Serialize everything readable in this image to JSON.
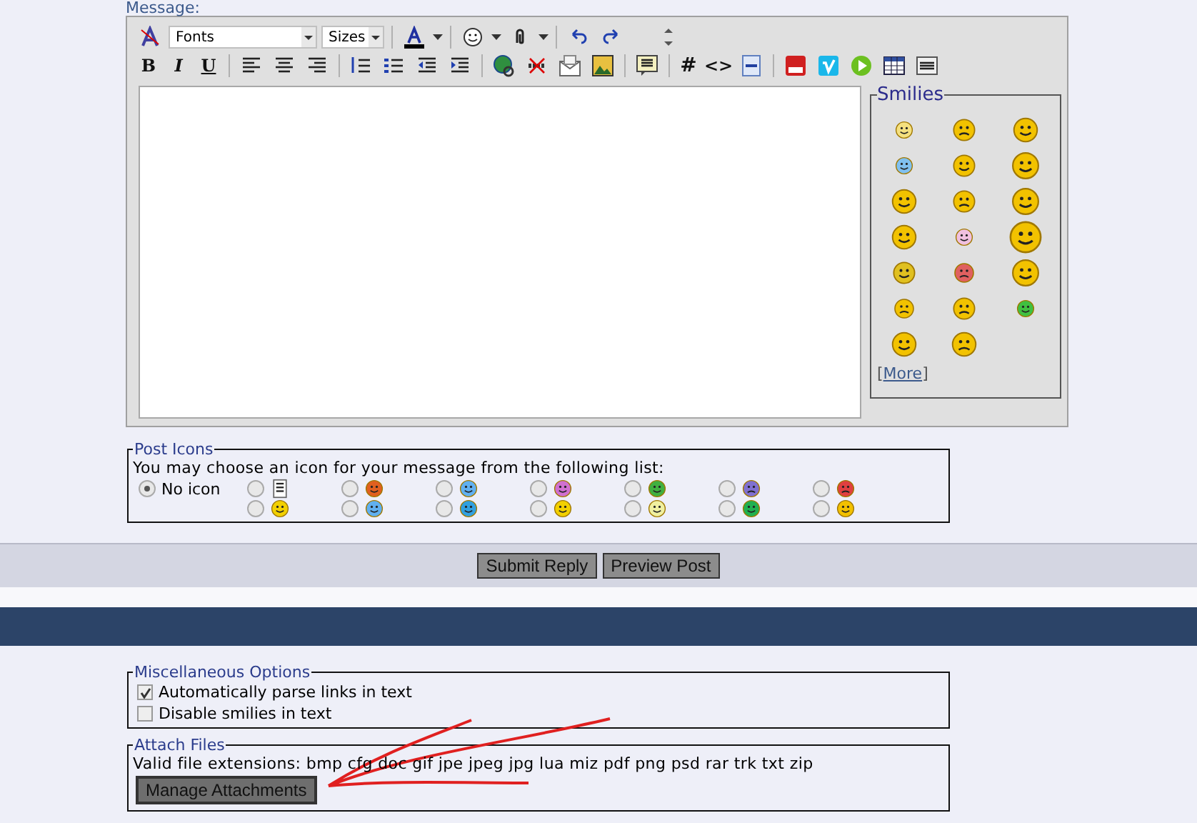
{
  "message_label": "Message:",
  "editor": {
    "fonts_select": "Fonts",
    "sizes_select": "Sizes",
    "bold": "B",
    "italic": "I",
    "underline": "U",
    "hash": "#",
    "code": "<>"
  },
  "smilies": {
    "title": "Smilies",
    "more_prefix": "[",
    "more_link": "More",
    "more_suffix": "]"
  },
  "post_icons": {
    "title": "Post Icons",
    "prompt": "You may choose an icon for your message from the following list:",
    "options": [
      {
        "label": "No icon",
        "selected": true
      },
      {
        "selected": false
      },
      {
        "selected": false
      },
      {
        "selected": false
      },
      {
        "selected": false
      },
      {
        "selected": false
      },
      {
        "selected": false
      },
      {
        "selected": false
      },
      {
        "selected": false
      },
      {
        "selected": false
      },
      {
        "selected": false
      },
      {
        "selected": false
      },
      {
        "selected": false
      },
      {
        "selected": false
      },
      {
        "selected": false
      }
    ]
  },
  "buttons": [
    "Submit Reply",
    "Preview Post"
  ],
  "misc_options": {
    "title": "Miscellaneous Options",
    "items": [
      {
        "label": "Automatically parse links in text",
        "checked": true
      },
      {
        "label": "Disable smilies in text",
        "checked": false
      }
    ]
  },
  "attach_files": {
    "title": "Attach Files",
    "extensions": "Valid file extensions: bmp cfg doc gif jpe jpeg jpg lua miz pdf png psd rar trk txt zip",
    "button": "Manage Attachments"
  }
}
